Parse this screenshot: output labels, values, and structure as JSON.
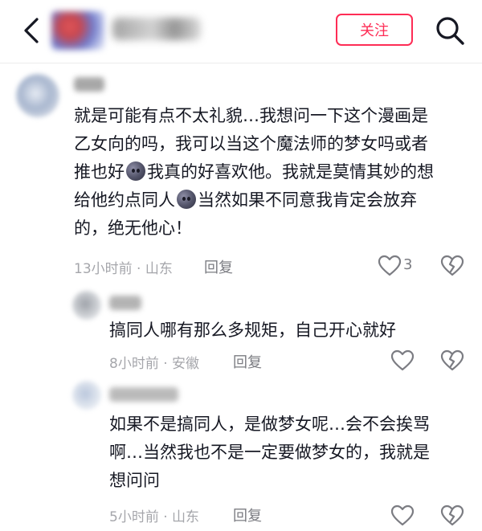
{
  "header": {
    "follow_label": "关注"
  },
  "comments": [
    {
      "lines": [
        "就是可能有点不太礼貌…我想问一下这个漫画是",
        "乙女向的吗，我可以当这个魔法师的梦女吗或者",
        "推也好",
        "我真的好喜欢他。我就是莫情其妙的想",
        "给他约点同人",
        "当然如果不同意我肯定会放弃",
        "的，绝无他心！"
      ],
      "time": "13小时前 · 山东",
      "reply": "回复",
      "likes": "3"
    },
    {
      "lines": [
        "搞同人哪有那么多规矩，自己开心就好"
      ],
      "time": "8小时前 · 安徽",
      "reply": "回复"
    },
    {
      "lines": [
        "如果不是搞同人，是做梦女呢…会不会挨骂",
        "啊…当然我也不是一定要做梦女的，我就是",
        "想问问"
      ],
      "time": "5小时前 · 山东",
      "reply": "回复"
    }
  ],
  "colors": {
    "accent": "#fe2c55",
    "meta": "#a5a6ab",
    "text": "#161823"
  },
  "icons": [
    "back-arrow-icon",
    "search-icon",
    "heart-icon",
    "broken-heart-icon",
    "blushing-emoji-icon"
  ]
}
